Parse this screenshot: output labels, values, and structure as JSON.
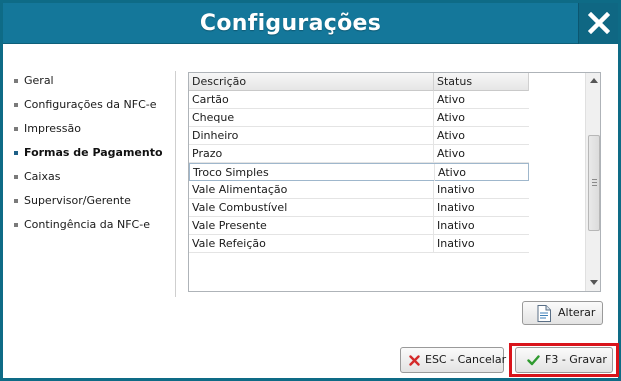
{
  "window": {
    "title": "Configurações",
    "close_label": "X",
    "accent_color": "#14779a",
    "highlight_color": "#d9141b"
  },
  "sidebar": {
    "items": [
      {
        "label": "Geral",
        "active": false
      },
      {
        "label": "Configurações da NFC-e",
        "active": false
      },
      {
        "label": "Impressão",
        "active": false
      },
      {
        "label": "Formas de Pagamento",
        "active": true
      },
      {
        "label": "Caixas",
        "active": false
      },
      {
        "label": "Supervisor/Gerente",
        "active": false
      },
      {
        "label": "Contingência da NFC-e",
        "active": false
      }
    ]
  },
  "grid": {
    "columns": [
      "Descrição",
      "Status"
    ],
    "rows": [
      {
        "descricao": "Cartão",
        "status": "Ativo"
      },
      {
        "descricao": "Cheque",
        "status": "Ativo"
      },
      {
        "descricao": "Dinheiro",
        "status": "Ativo"
      },
      {
        "descricao": "Prazo",
        "status": "Ativo"
      },
      {
        "descricao": "Troco Simples",
        "status": "Ativo"
      },
      {
        "descricao": "Vale Alimentação",
        "status": "Inativo"
      },
      {
        "descricao": "Vale Combustível",
        "status": "Inativo"
      },
      {
        "descricao": "Vale Presente",
        "status": "Inativo"
      },
      {
        "descricao": "Vale Refeição",
        "status": "Inativo"
      }
    ],
    "selected_row": "Troco Simples"
  },
  "buttons": {
    "alterar": {
      "label": "Alterar",
      "icon": "document-edit-icon"
    },
    "cancel": {
      "label": "ESC - Cancelar",
      "icon": "x-icon"
    },
    "save": {
      "label": "F3 - Gravar",
      "icon": "checkmark-icon"
    }
  }
}
